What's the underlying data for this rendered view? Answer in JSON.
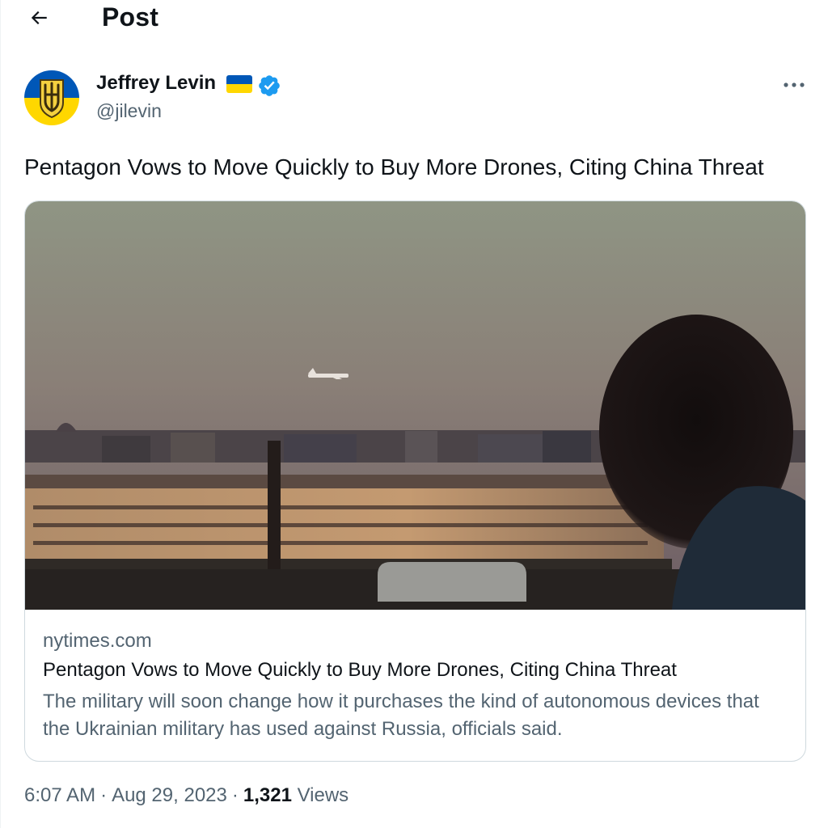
{
  "header": {
    "title": "Post",
    "back_icon": "arrow-left-icon"
  },
  "author": {
    "name": "Jeffrey Levin",
    "handle": "@jilevin",
    "flag_icon": "ukraine-flag-icon",
    "verified_icon": "verified-badge-icon"
  },
  "post": {
    "text": "Pentagon Vows to Move Quickly to Buy More Drones, Citing China Threat"
  },
  "card": {
    "domain": "nytimes.com",
    "title": "Pentagon Vows to Move Quickly to Buy More Drones, Citing China Threat",
    "description": "The military will soon change how it purchases the kind of autonomous devices that the Ukrainian military has used against Russia, officials said."
  },
  "meta": {
    "time": "6:07 AM",
    "date": "Aug 29, 2023",
    "views_count": "1,321",
    "views_label": "Views"
  },
  "colors": {
    "accent": "#1d9bf0",
    "text": "#0f1419",
    "secondary": "#536471",
    "border": "#cfd9de",
    "flag_blue": "#0057b7",
    "flag_yellow": "#ffd700"
  }
}
